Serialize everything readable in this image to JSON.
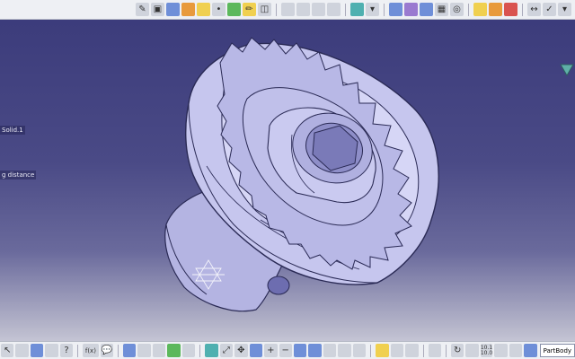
{
  "tree": {
    "solid_label": "Solid.1",
    "distance_label": "g distance"
  },
  "toolbar_top": {
    "icons": [
      "sketch-icon",
      "snapshot-icon",
      "wireframe-icon",
      "surface-icon",
      "plane-icon",
      "point-icon",
      "line-icon",
      "pencil-icon",
      "pad-icon",
      "pocket-icon",
      "shaft-icon",
      "hole-icon",
      "transform-icon",
      "fillet-icon",
      "chamfer-icon",
      "draft-icon",
      "shell-icon",
      "thread-icon",
      "grid-icon",
      "sketcher-icon",
      "analysis-icon",
      "tool-icon",
      "render-icon",
      "measure-icon",
      "apply-material-icon"
    ]
  },
  "toolbar_bottom": {
    "part_body_label": "PartBody",
    "formula_label": "f(x)",
    "coords_label_1": "10.1",
    "coords_label_2": "10.0"
  },
  "colors": {
    "background_top": "#3a3a7a",
    "background_bottom": "#d6d6e2",
    "model_fill": "#c8c8ee",
    "model_shade": "#9c9ccc",
    "toolbar_bg": "#eef0f4"
  }
}
